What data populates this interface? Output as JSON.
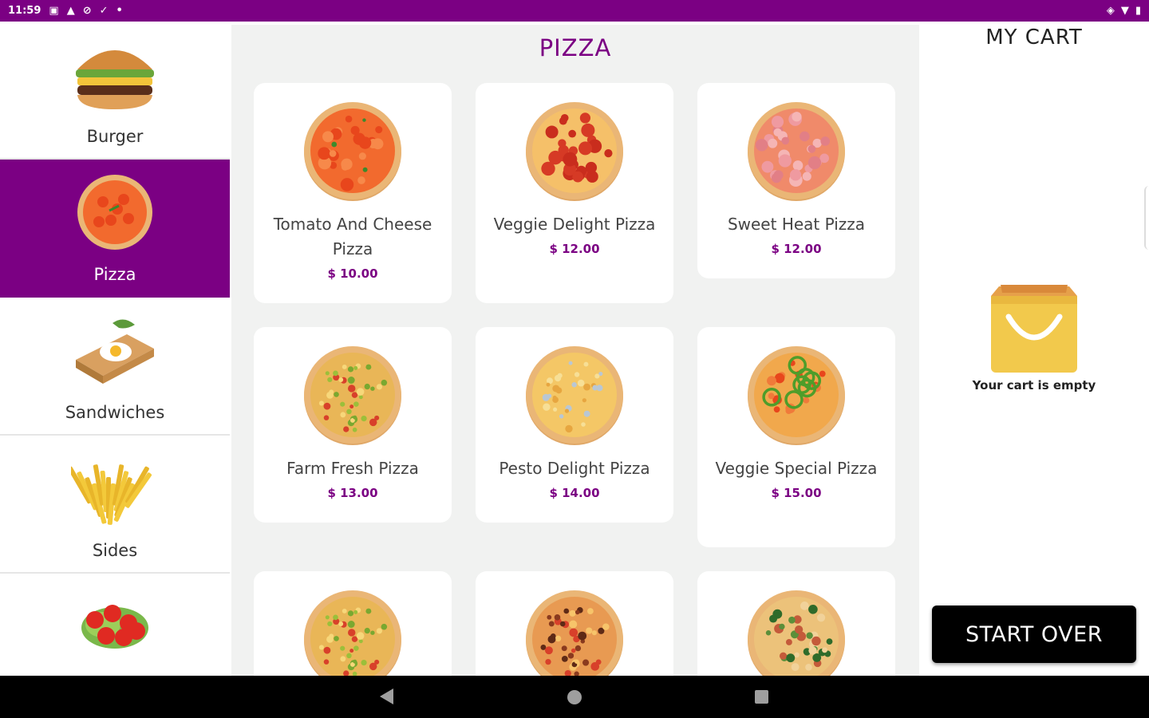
{
  "status_bar": {
    "time": "11:59",
    "left_icons": [
      "calendar-icon",
      "warning-icon",
      "no-disturb-icon",
      "check-icon",
      "dot-icon"
    ],
    "right_icons": [
      "data-saver-icon",
      "wifi-icon",
      "battery-icon"
    ]
  },
  "categories": [
    {
      "label": "Burger",
      "icon": "burger-icon",
      "active": false
    },
    {
      "label": "Pizza",
      "icon": "pizza-icon",
      "active": true
    },
    {
      "label": "Sandwiches",
      "icon": "sandwich-icon",
      "active": false
    },
    {
      "label": "Sides",
      "icon": "fries-icon",
      "active": false
    },
    {
      "label": "",
      "icon": "salad-icon",
      "active": false
    }
  ],
  "menu": {
    "title": "PIZZA",
    "items": [
      {
        "name": "Tomato And Cheese Pizza",
        "price": "$ 10.00",
        "style": "tomato"
      },
      {
        "name": "Veggie Delight Pizza",
        "price": "$ 12.00",
        "style": "pepperoni"
      },
      {
        "name": "Sweet Heat Pizza",
        "price": "$ 12.00",
        "style": "ham"
      },
      {
        "name": "Farm Fresh Pizza",
        "price": "$ 13.00",
        "style": "farm"
      },
      {
        "name": "Pesto Delight Pizza",
        "price": "$ 14.00",
        "style": "cheese"
      },
      {
        "name": "Veggie Special Pizza",
        "price": "$ 15.00",
        "style": "pepper"
      },
      {
        "name": "",
        "price": "",
        "style": "farm"
      },
      {
        "name": "",
        "price": "",
        "style": "meat"
      },
      {
        "name": "",
        "price": "",
        "style": "spinach"
      }
    ]
  },
  "cart": {
    "title": "MY CART",
    "empty_message": "Your cart is empty",
    "start_over_label": "START OVER"
  },
  "colors": {
    "brand": "#7b0083",
    "panel_bg": "#f1f2f1",
    "button_bg": "#000000",
    "bag": "#f2c94c"
  }
}
